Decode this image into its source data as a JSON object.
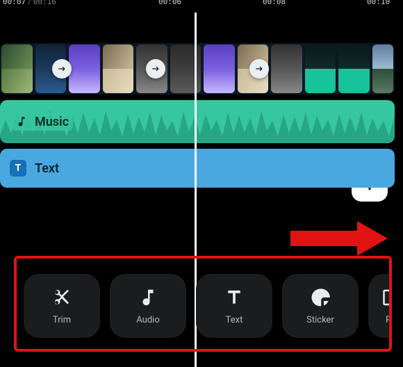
{
  "timecodes": {
    "current_pos": "00:07",
    "current_dur": "00:16",
    "tick_6s": "00:06",
    "tick_8s": "00:08",
    "tick_10s": "00:10"
  },
  "tracks": {
    "music_label": "Music",
    "text_badge": "T",
    "text_label": "Text"
  },
  "toolbar": {
    "trim": "Trim",
    "audio": "Audio",
    "text": "Text",
    "sticker": "Sticker",
    "pip": "PIP"
  },
  "colors": {
    "music": "#36c7a0",
    "text_track": "#4aa8e0",
    "annotation": "#e11313"
  }
}
